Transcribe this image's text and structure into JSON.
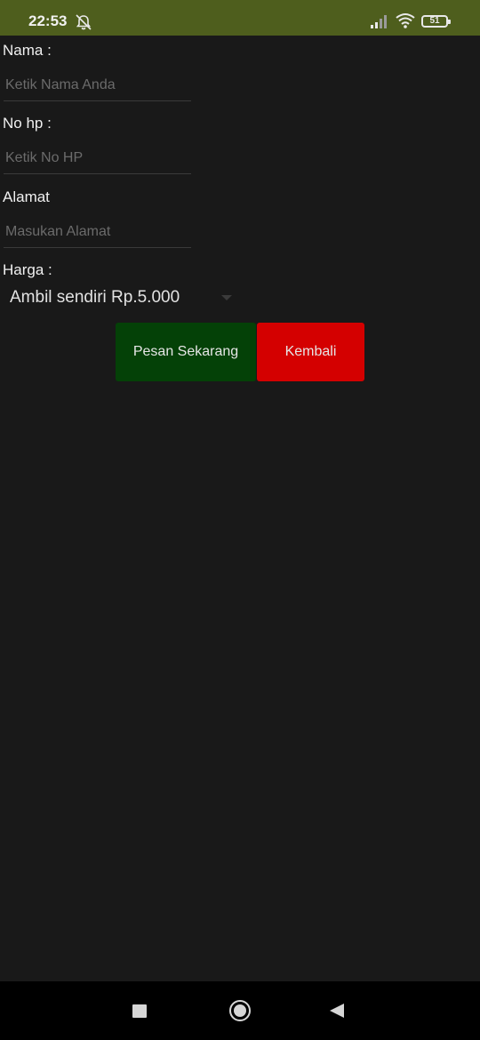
{
  "status_bar": {
    "time": "22:53",
    "battery_level": "51",
    "icons": [
      "bell-off-icon",
      "signal-icon",
      "wifi-icon",
      "battery-icon"
    ],
    "background_color": "#4e5e1d"
  },
  "form": {
    "nama": {
      "label": "Nama :",
      "placeholder": "Ketik Nama Anda",
      "value": ""
    },
    "no_hp": {
      "label": "No hp :",
      "placeholder": "Ketik No HP",
      "value": ""
    },
    "alamat": {
      "label": "Alamat",
      "placeholder": "Masukan Alamat",
      "value": ""
    },
    "harga": {
      "label": "Harga :",
      "selected": "Ambil sendiri Rp.5.000"
    }
  },
  "buttons": {
    "pesan_label": "Pesan Sekarang",
    "pesan_color": "#044107",
    "kembali_label": "Kembali",
    "kembali_color": "#d40000"
  },
  "nav_bar": {
    "icons": [
      "recent-apps-icon",
      "home-icon",
      "back-icon"
    ]
  }
}
